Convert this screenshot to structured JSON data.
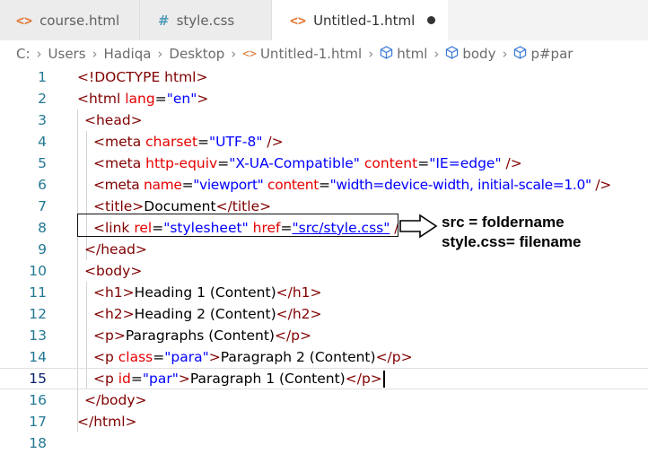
{
  "tabs": [
    {
      "label": "course.html",
      "icon": "html-file-icon"
    },
    {
      "label": "style.css",
      "icon": "css-file-icon"
    },
    {
      "label": "Untitled-1.html",
      "icon": "html-file-icon",
      "modified": true
    }
  ],
  "breadcrumb": [
    "C:",
    "Users",
    "Hadiqa",
    "Desktop",
    "Untitled-1.html",
    "html",
    "body",
    "p#par"
  ],
  "line_numbers": [
    "1",
    "2",
    "3",
    "4",
    "5",
    "6",
    "7",
    "8",
    "9",
    "10",
    "11",
    "12",
    "13",
    "14",
    "15",
    "16",
    "17",
    "18"
  ],
  "code": {
    "l1": {
      "t1": "<!DOCTYPE html>"
    },
    "l2": {
      "t1": "<html",
      "a1": " lang",
      "p1": "=",
      "v1": "\"en\"",
      "t2": ">"
    },
    "l3": {
      "t1": "<head>"
    },
    "l4": {
      "t1": "<meta",
      "a1": " charset",
      "p1": "=",
      "v1": "\"UTF-8\"",
      "t2": " />"
    },
    "l5": {
      "t1": "<meta",
      "a1": " http-equiv",
      "p1": "=",
      "v1": "\"X-UA-Compatible\"",
      "a2": " content",
      "p2": "=",
      "v2": "\"IE=edge\"",
      "t2": " />"
    },
    "l6": {
      "t1": "<meta",
      "a1": " name",
      "p1": "=",
      "v1": "\"viewport\"",
      "a2": " content",
      "p2": "=",
      "v2": "\"width=device-width, initial-scale=1.0\"",
      "t2": " />"
    },
    "l7": {
      "t1": "<title>",
      "x1": "Document",
      "t2": "</title>"
    },
    "l8": {
      "t1": "<link",
      "a1": " rel",
      "p1": "=",
      "v1": "\"stylesheet\"",
      "a2": " href",
      "p2": "=",
      "v2": "\"src/style.css\"",
      "t2": " />"
    },
    "l9": {
      "t1": "</head>"
    },
    "l10": {
      "t1": "<body>"
    },
    "l11": {
      "t1": "<h1>",
      "x1": "Heading 1 (Content)",
      "t2": "</h1>"
    },
    "l12": {
      "t1": "<h2>",
      "x1": "Heading 2 (Content)",
      "t2": "</h2>"
    },
    "l13": {
      "t1": "<p>",
      "x1": "Paragraphs (Content)",
      "t2": "</p>"
    },
    "l14": {
      "t1": "<p",
      "a1": " class",
      "p1": "=",
      "v1": "\"para\"",
      "t2": ">",
      "x1": "Paragraph 2 (Content)",
      "t3": "</p>"
    },
    "l15": {
      "t1": "<p",
      "a1": " id",
      "p1": "=",
      "v1": "\"par\"",
      "t2": ">",
      "x1": "Paragraph 1 (Content)",
      "t3": "</p>"
    },
    "l16": {
      "t1": "</body>"
    },
    "l17": {
      "t1": "</html>"
    }
  },
  "annotation": {
    "line1": "src = foldername",
    "line2": "style.css= filename"
  },
  "colors": {
    "tag": "#800000",
    "attribute": "#e50000",
    "value": "#0000ff",
    "line_number": "#237893"
  }
}
